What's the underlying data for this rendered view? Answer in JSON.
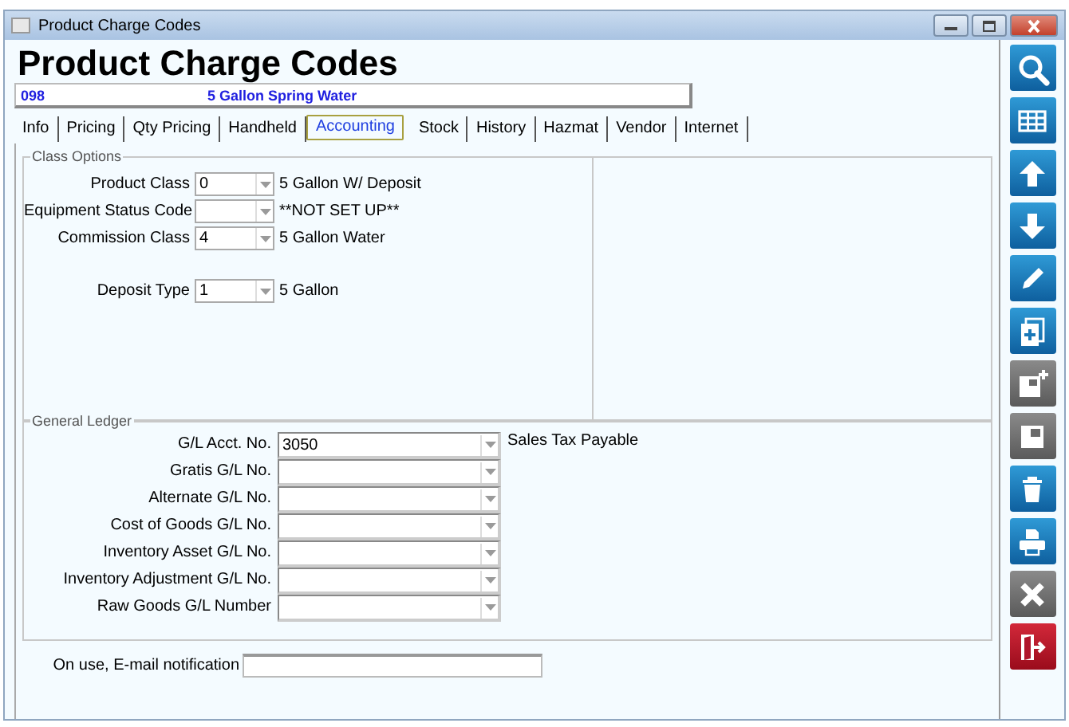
{
  "window": {
    "title": "Product Charge Codes"
  },
  "heading": "Product Charge Codes",
  "record": {
    "code": "098",
    "description": "5 Gallon Spring Water"
  },
  "tabs": [
    {
      "label": "Info",
      "selected": false
    },
    {
      "label": "Pricing",
      "selected": false
    },
    {
      "label": "Qty Pricing",
      "selected": false
    },
    {
      "label": "Handheld",
      "selected": false
    },
    {
      "label": "Accounting",
      "selected": true
    },
    {
      "label": "Stock",
      "selected": false
    },
    {
      "label": "History",
      "selected": false
    },
    {
      "label": "Hazmat",
      "selected": false
    },
    {
      "label": "Vendor",
      "selected": false
    },
    {
      "label": "Internet",
      "selected": false
    }
  ],
  "class_options": {
    "title": "Class Options",
    "rows": [
      {
        "label": "Product Class",
        "value": "0",
        "description": "5 Gallon W/ Deposit"
      },
      {
        "label": "Equipment Status Code",
        "description": "**NOT SET UP**"
      },
      {
        "label": "Commission Class",
        "value": "4",
        "description": "5 Gallon Water"
      },
      {
        "label": "Deposit Type",
        "value": "1",
        "description": "5 Gallon",
        "spaced": true
      }
    ]
  },
  "general_ledger": {
    "title": "General Ledger",
    "rows": [
      {
        "label": "G/L Acct. No.",
        "value": "3050",
        "description": "Sales Tax Payable"
      },
      {
        "label": "Gratis G/L No."
      },
      {
        "label": "Alternate G/L No."
      },
      {
        "label": "Cost of Goods G/L No."
      },
      {
        "label": "Inventory Asset G/L No."
      },
      {
        "label": "Inventory Adjustment G/L No."
      },
      {
        "label": "Raw Goods G/L Number"
      }
    ]
  },
  "email": {
    "label": "On use, E-mail notification"
  },
  "toolbar": [
    {
      "kind": "search",
      "disabled": false
    },
    {
      "kind": "grid",
      "disabled": false
    },
    {
      "kind": "up",
      "disabled": false
    },
    {
      "kind": "down",
      "disabled": false
    },
    {
      "kind": "edit",
      "disabled": false
    },
    {
      "kind": "copy",
      "disabled": false
    },
    {
      "kind": "save-new",
      "disabled": true
    },
    {
      "kind": "save",
      "disabled": true
    },
    {
      "kind": "delete",
      "disabled": false
    },
    {
      "kind": "print",
      "disabled": false
    },
    {
      "kind": "cancel",
      "disabled": true
    },
    {
      "kind": "exit",
      "disabled": false
    }
  ]
}
